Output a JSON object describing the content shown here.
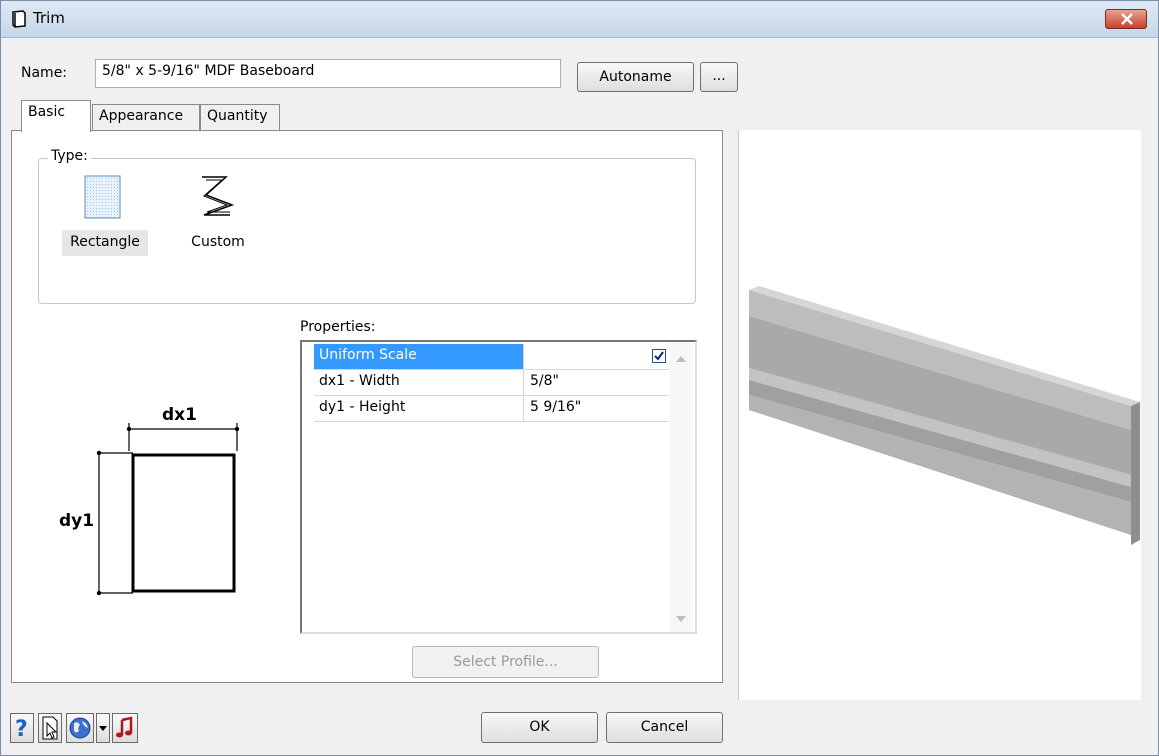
{
  "window": {
    "title": "Trim"
  },
  "name_field": {
    "label": "Name:",
    "value": "5/8\" x 5-9/16\" MDF Baseboard"
  },
  "buttons": {
    "autoname": "Autoname",
    "more": "...",
    "ok": "OK",
    "cancel": "Cancel",
    "select_profile": "Select Profile..."
  },
  "tabs": [
    {
      "label": "Basic",
      "active": true
    },
    {
      "label": "Appearance",
      "active": false
    },
    {
      "label": "Quantity",
      "active": false
    }
  ],
  "type_group": {
    "legend": "Type:",
    "options": [
      {
        "label": "Rectangle",
        "selected": true,
        "icon": "rectangle-icon"
      },
      {
        "label": "Custom",
        "selected": false,
        "icon": "custom-profile-icon"
      }
    ]
  },
  "diagram": {
    "width_label": "dx1",
    "height_label": "dy1"
  },
  "properties": {
    "label": "Properties:",
    "rows": [
      {
        "name": "Uniform Scale",
        "value": "",
        "checked": true,
        "selected": true
      },
      {
        "name": "dx1 - Width",
        "value": "5/8\""
      },
      {
        "name": "dy1 - Height",
        "value": "5 9/16\""
      }
    ]
  },
  "footer_icons": [
    "help-icon",
    "info-cursor-icon",
    "globe-icon",
    "dropdown-arrow-icon",
    "music-note-icon"
  ],
  "colors": {
    "selection": "#3399ff",
    "close_button": "#c9412b",
    "help_accent": "#1e5fc9",
    "music_accent": "#b01818"
  }
}
